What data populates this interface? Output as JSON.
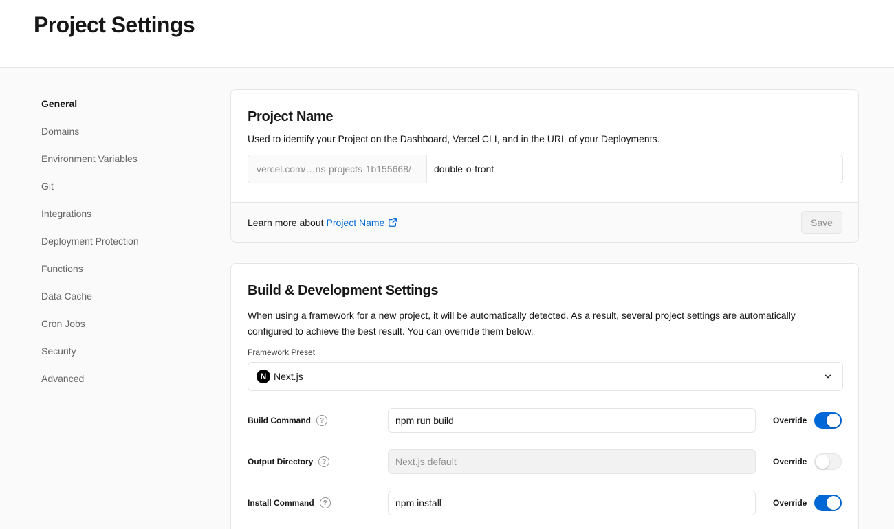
{
  "header": {
    "title": "Project Settings"
  },
  "sidebar": {
    "items": [
      {
        "label": "General",
        "active": true
      },
      {
        "label": "Domains"
      },
      {
        "label": "Environment Variables"
      },
      {
        "label": "Git"
      },
      {
        "label": "Integrations"
      },
      {
        "label": "Deployment Protection"
      },
      {
        "label": "Functions"
      },
      {
        "label": "Data Cache"
      },
      {
        "label": "Cron Jobs"
      },
      {
        "label": "Security"
      },
      {
        "label": "Advanced"
      }
    ]
  },
  "project_name": {
    "title": "Project Name",
    "description": "Used to identify your Project on the Dashboard, Vercel CLI, and in the URL of your Deployments.",
    "prefix": "vercel.com/…ns-projects-1b155668/",
    "value": "double-o-front",
    "footer_text": "Learn more about",
    "footer_link": "Project Name",
    "save_label": "Save"
  },
  "build": {
    "title": "Build & Development Settings",
    "description": "When using a framework for a new project, it will be automatically detected. As a result, several project settings are automatically configured to achieve the best result. You can override them below.",
    "preset_label": "Framework Preset",
    "preset_logo": "N",
    "preset_value": "Next.js",
    "override_label": "Override",
    "rows": [
      {
        "label": "Build Command",
        "value": "npm run build",
        "placeholder": "",
        "override": true
      },
      {
        "label": "Output Directory",
        "value": "",
        "placeholder": "Next.js default",
        "override": false
      },
      {
        "label": "Install Command",
        "value": "npm install",
        "placeholder": "",
        "override": true
      }
    ]
  },
  "colors": {
    "accent": "#0068d6",
    "text": "#171717",
    "muted": "#666666",
    "border": "#e5e5e5",
    "background": "#fafafa"
  },
  "icons": {
    "help": "question-mark-circle-icon",
    "external": "external-link-icon",
    "chevron": "chevron-down-icon",
    "framework": "nextjs-logo-icon"
  }
}
